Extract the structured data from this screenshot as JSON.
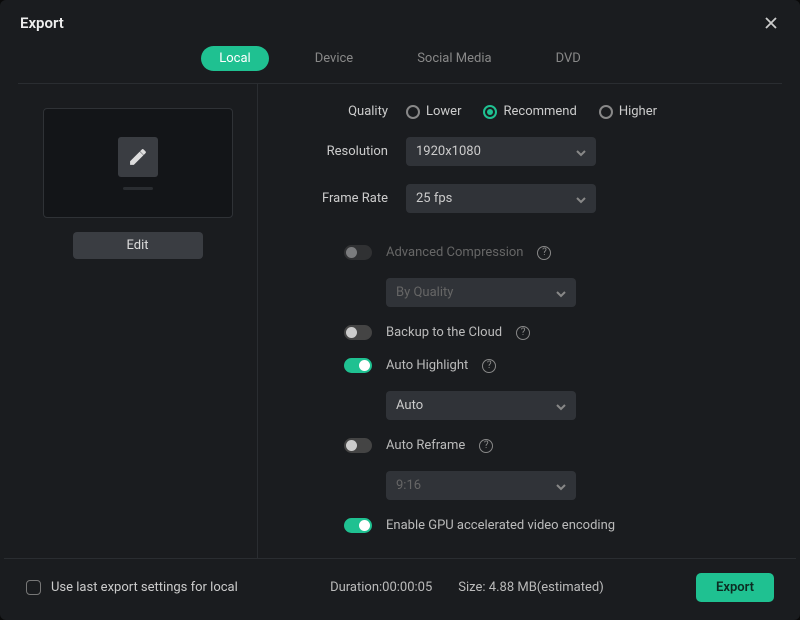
{
  "header": {
    "title": "Export"
  },
  "tabs": {
    "t0": "Local",
    "t1": "Device",
    "t2": "Social Media",
    "t3": "DVD"
  },
  "left": {
    "edit": "Edit"
  },
  "settings": {
    "quality_label": "Quality",
    "quality_options": {
      "lower": "Lower",
      "recommend": "Recommend",
      "higher": "Higher"
    },
    "resolution_label": "Resolution",
    "resolution_value": "1920x1080",
    "framerate_label": "Frame Rate",
    "framerate_value": "25 fps",
    "adv_compression": "Advanced Compression",
    "adv_compression_select": "By Quality",
    "backup_cloud": "Backup to the Cloud",
    "auto_highlight": "Auto Highlight",
    "auto_highlight_select": "Auto",
    "auto_reframe": "Auto Reframe",
    "auto_reframe_select": "9:16",
    "gpu_encode": "Enable GPU accelerated video encoding"
  },
  "footer": {
    "use_last": "Use last export settings for local",
    "duration": "Duration:00:00:05",
    "size": "Size: 4.88 MB(estimated)",
    "export_btn": "Export"
  }
}
